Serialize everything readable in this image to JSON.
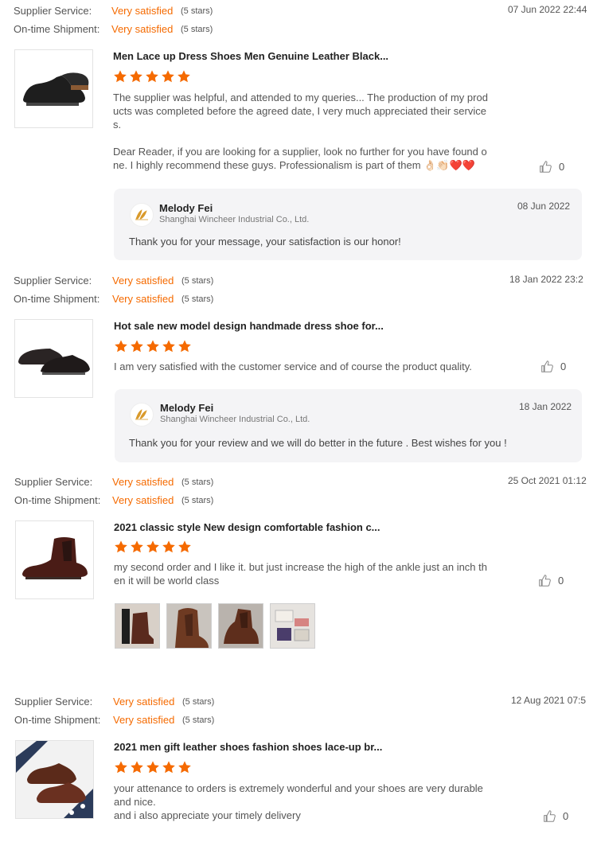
{
  "labels": {
    "supplier_service": "Supplier Service:",
    "ontime_shipment": "On-time Shipment:"
  },
  "colors": {
    "accent": "#f56a00",
    "stars": "#f56a00"
  },
  "reviews": [
    {
      "supplier_service": "Very satisfied",
      "supplier_stars": "(5 stars)",
      "ontime_shipment": "Very satisfied",
      "ontime_stars": "(5 stars)",
      "date": "07 Jun 2022 22:44",
      "product_title": "Men Lace up Dress Shoes Men Genuine Leather Black...",
      "rating": 5,
      "text_lines": [
        "The supplier was helpful, and attended to my queries... The production of my prod",
        "ucts was completed before the agreed date, I very much appreciated their service",
        "s.",
        "",
        "Dear Reader, if you are looking for a supplier, look no further for you have found o",
        "ne. I highly recommend these guys. Professionalism is part of them 👌🏻👏🏻❤️❤️"
      ],
      "likes": "0",
      "reply": {
        "name": "Melody Fei",
        "company": "Shanghai Wincheer Industrial Co., Ltd.",
        "date": "08 Jun 2022",
        "text": "Thank you for your message, your satisfaction is our honor!"
      }
    },
    {
      "supplier_service": "Very satisfied",
      "supplier_stars": "(5 stars)",
      "ontime_shipment": "Very satisfied",
      "ontime_stars": "(5 stars)",
      "date": "18 Jan 2022 23:2",
      "product_title": "Hot sale new model design handmade dress shoe for...",
      "rating": 5,
      "text_lines": [
        "I am very satisfied with the customer service and of course the product quality."
      ],
      "likes": "0",
      "reply": {
        "name": "Melody Fei",
        "company": "Shanghai Wincheer Industrial Co., Ltd.",
        "date": "18 Jan 2022",
        "text": "Thank you for your review and we will do better in the future . Best wishes for you !"
      }
    },
    {
      "supplier_service": "Very satisfied",
      "supplier_stars": "(5 stars)",
      "ontime_shipment": "Very satisfied",
      "ontime_stars": "(5 stars)",
      "date": "25 Oct 2021 01:12",
      "product_title": "2021 classic style New design comfortable fashion c...",
      "rating": 5,
      "text_lines": [
        "my second order and I like it. but just increase the high of the ankle just an inch th",
        "en it will be world class"
      ],
      "likes": "0"
    },
    {
      "supplier_service": "Very satisfied",
      "supplier_stars": "(5 stars)",
      "ontime_shipment": "Very satisfied",
      "ontime_stars": "(5 stars)",
      "date": "12 Aug 2021 07:5",
      "product_title": "2021 men gift leather shoes fashion shoes lace-up br...",
      "rating": 5,
      "text_lines": [
        "your attenance to orders is extremely wonderful and your shoes are very durable",
        "and nice.",
        "and i also appreciate your timely delivery"
      ],
      "likes": "0"
    }
  ]
}
